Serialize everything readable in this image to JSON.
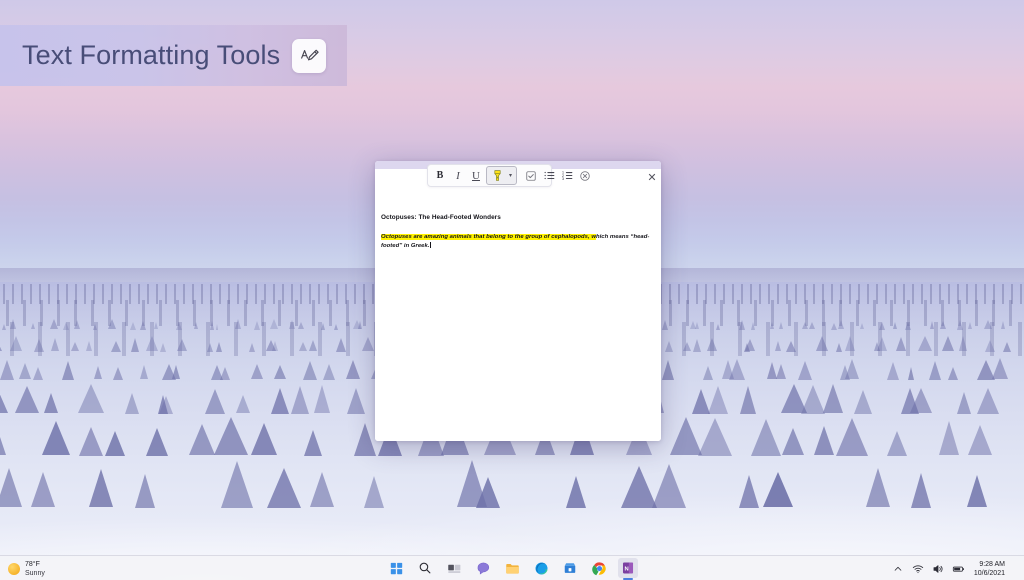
{
  "header_card": {
    "title": "Text Formatting Tools",
    "badge_icon": "text-pen-icon"
  },
  "editor": {
    "toolbar": {
      "bold": {
        "label": "B",
        "name": "bold-button",
        "active": false
      },
      "italic": {
        "label": "I",
        "name": "italic-button",
        "active": false
      },
      "underline": {
        "label": "U",
        "name": "underline-button",
        "active": false
      },
      "highlight": {
        "label": "highlighter-icon",
        "name": "highlight-button",
        "active": true
      },
      "highlight_caret": {
        "label": "▾",
        "name": "highlight-dropdown-caret"
      },
      "checklist": {
        "label": "checklist-icon",
        "name": "checklist-button",
        "active": false
      },
      "bulleted_list": {
        "label": "bulleted-list-icon",
        "name": "bulleted-list-button",
        "active": false
      },
      "numbered_list": {
        "label": "numbered-list-icon",
        "name": "numbered-list-button",
        "active": false
      },
      "clear_formatting": {
        "label": "clear-formatting-icon",
        "name": "clear-formatting-button",
        "active": false
      }
    },
    "close_label": "✕",
    "document": {
      "heading": "Octopuses: The Head-Footed Wonders",
      "paragraph_highlighted": "Octopuses are amazing animals that belong to the group of cephalopods, w",
      "paragraph_plain": "hich means “head-footed” in Greek."
    }
  },
  "taskbar": {
    "weather": {
      "temperature": "78°F",
      "condition": "Sunny",
      "icon": "sun-icon"
    },
    "items": [
      {
        "name": "start-button",
        "icon": "windows-logo-icon",
        "active": false
      },
      {
        "name": "search-button",
        "icon": "search-icon",
        "active": false
      },
      {
        "name": "task-view-button",
        "icon": "task-view-icon",
        "active": false
      },
      {
        "name": "chat-button",
        "icon": "chat-icon",
        "active": false
      },
      {
        "name": "file-explorer-button",
        "icon": "folder-icon",
        "active": false
      },
      {
        "name": "edge-button",
        "icon": "edge-icon",
        "active": false
      },
      {
        "name": "microsoft-store-button",
        "icon": "store-icon",
        "active": false
      },
      {
        "name": "chrome-button",
        "icon": "chrome-icon",
        "active": false
      },
      {
        "name": "onenote-button",
        "icon": "onenote-icon",
        "active": true
      }
    ],
    "tray": {
      "chevron": "⌃",
      "wifi_icon": "wifi-icon",
      "volume_icon": "volume-icon",
      "battery_icon": "battery-icon",
      "time": "9:28 AM",
      "date": "10/6/2021"
    }
  },
  "colors": {
    "highlight_yellow": "#fff200",
    "title_text": "#3d4470",
    "accent_blue": "#4a7fe0"
  }
}
